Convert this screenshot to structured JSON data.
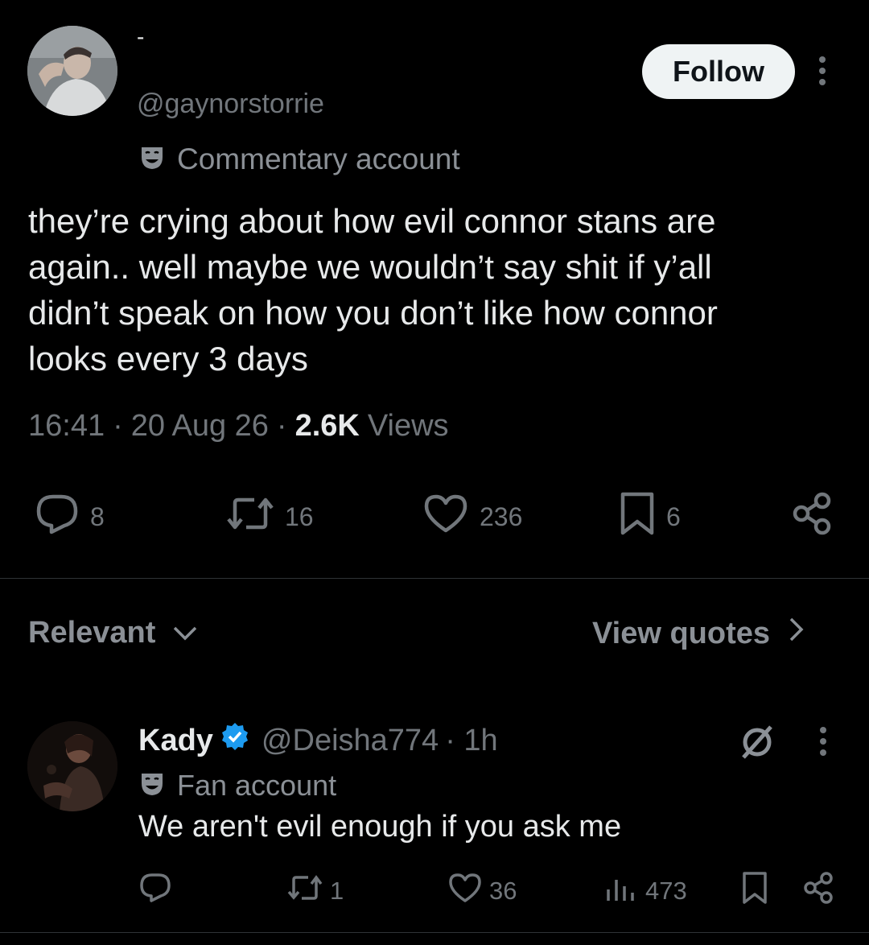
{
  "main_tweet": {
    "display_name": "-",
    "handle": "@gaynorstorrie",
    "follow_label": "Follow",
    "badge_label": "Commentary account",
    "text_lines": [
      "they’re crying about how evil connor stans are",
      "again.. well maybe we wouldn’t say shit if y’all",
      "didn’t speak on how you don’t like how connor",
      "looks every 3 days"
    ],
    "time": "16:41",
    "date": "20 Aug 26",
    "views_count": "2.6K",
    "views_label": "Views",
    "separator": "·",
    "replies": "8",
    "reposts": "16",
    "likes": "236",
    "bookmarks": "6"
  },
  "sort": {
    "relevant_label": "Relevant",
    "view_quotes_label": "View quotes"
  },
  "reply": {
    "display_name": "Kady",
    "handle": "@Deisha774",
    "time": "· 1h",
    "badge_label": "Fan account",
    "text": "We aren't evil enough if you ask me",
    "reposts": "1",
    "likes": "36",
    "views": "473"
  },
  "colors": {
    "background": "#000000",
    "text": "#e7e9ea",
    "muted": "#71767b",
    "verified": "#1d9bf0",
    "divider": "#2f3336"
  },
  "icons": [
    "mask-icon",
    "more-icon",
    "reply-icon",
    "repost-icon",
    "like-icon",
    "bookmark-icon",
    "share-icon",
    "chevron-down-icon",
    "chevron-right-icon",
    "verified-icon",
    "grok-icon",
    "views-icon"
  ]
}
